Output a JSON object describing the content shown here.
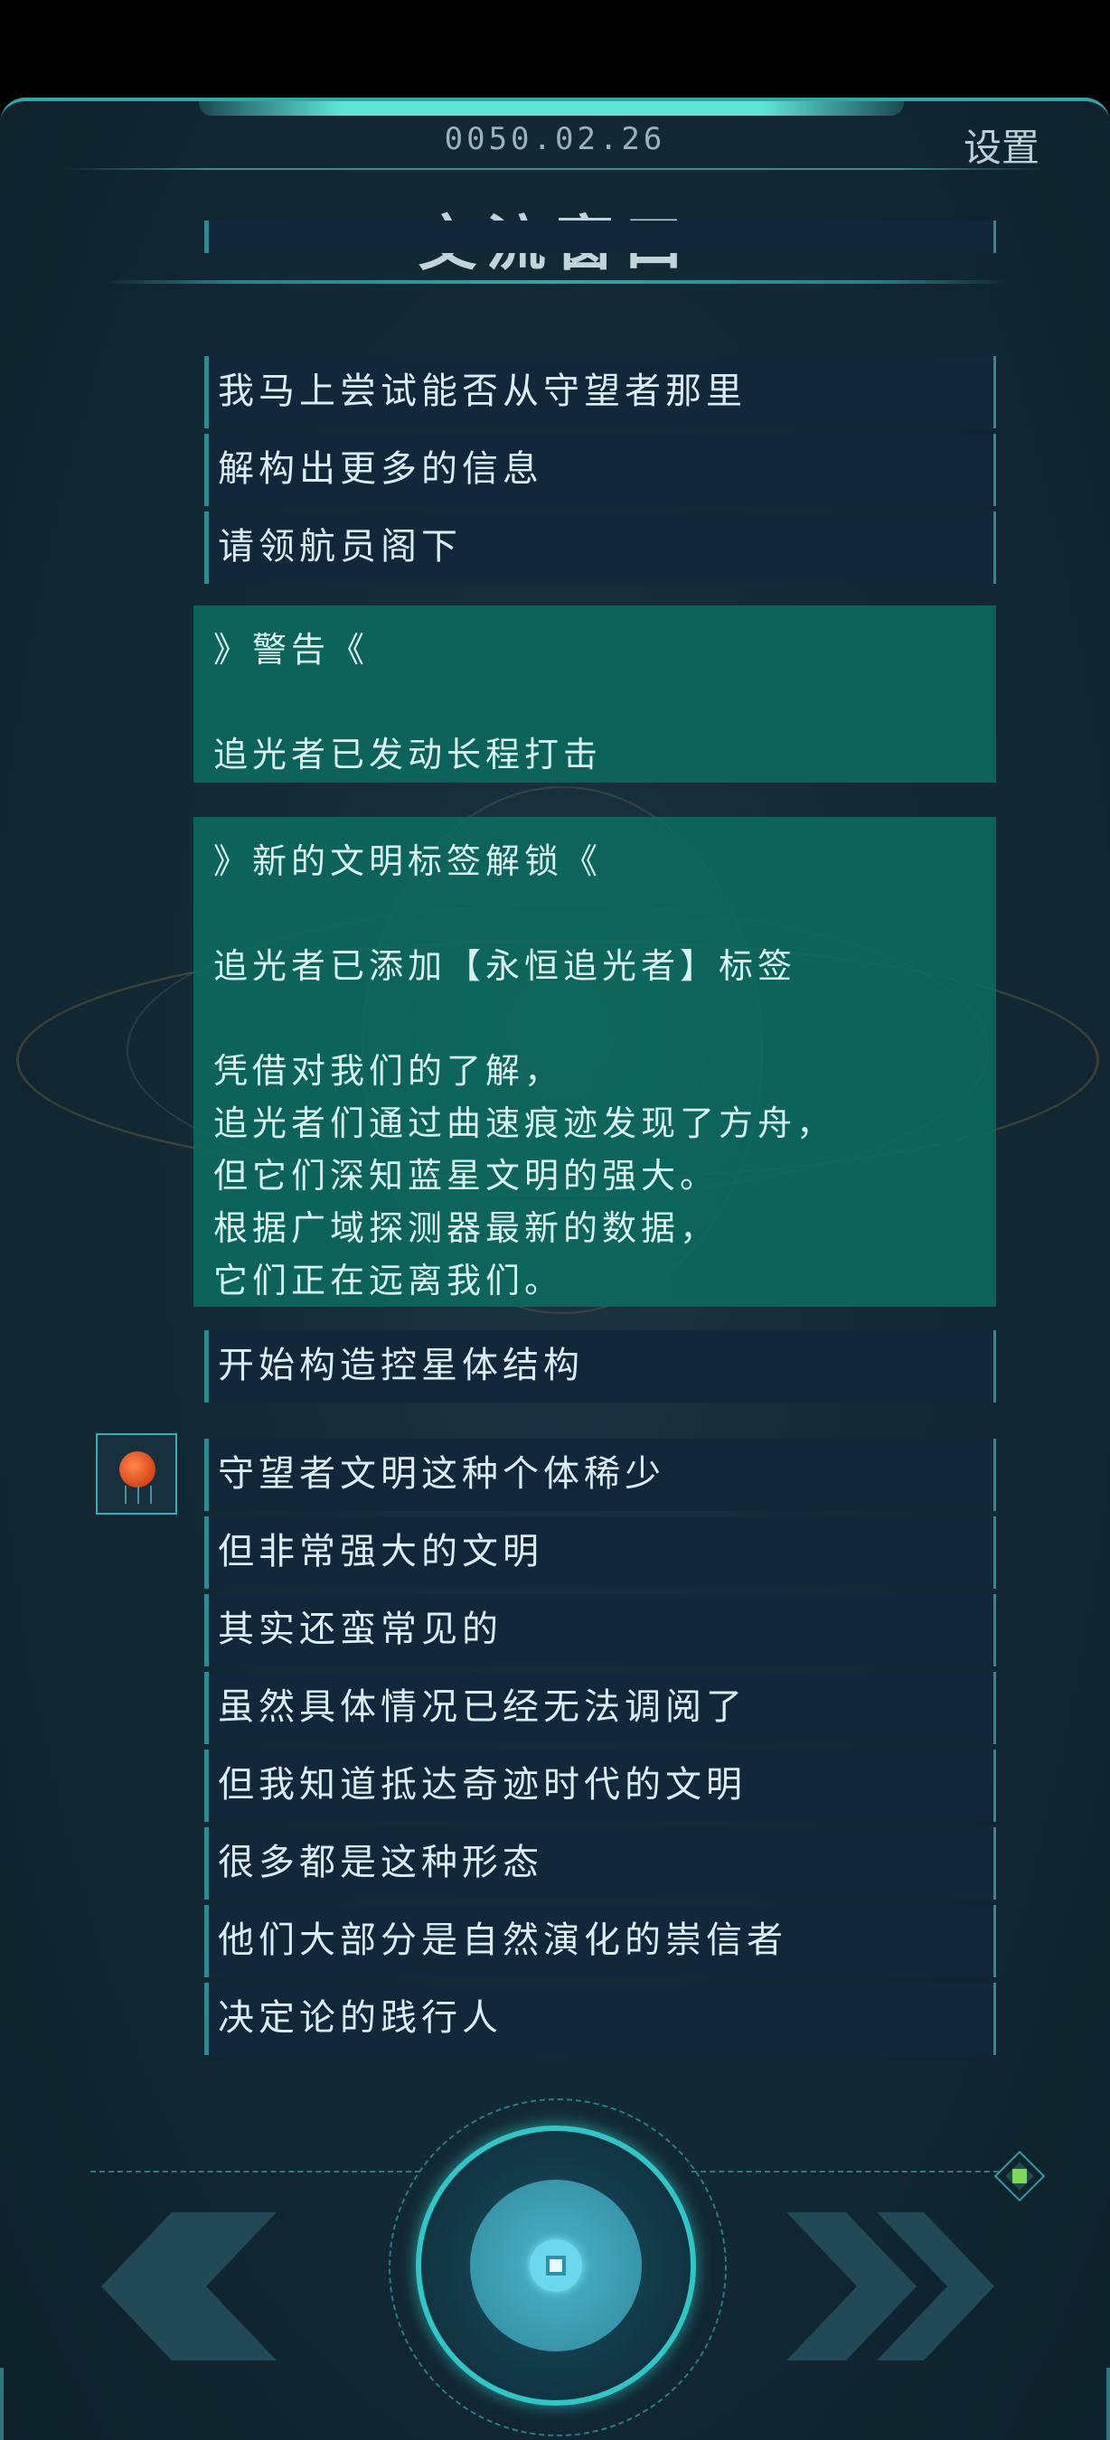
{
  "header": {
    "date": "0050.02.26",
    "settings_label": "设置",
    "title": "交流窗口"
  },
  "messages_top": [
    "我马上尝试能否从守望者那里",
    "解构出更多的信息",
    "请领航员阁下"
  ],
  "warning": {
    "heading": "》警告《",
    "body": "追光者已发动长程打击"
  },
  "unlock": {
    "heading": "》新的文明标签解锁《",
    "tag_line": "追光者已添加【永恒追光者】标签",
    "lines": [
      "凭借对我们的了解，",
      "追光者们通过曲速痕迹发现了方舟，",
      "但它们深知蓝星文明的强大。",
      "根据广域探测器最新的数据，",
      "它们正在远离我们。"
    ]
  },
  "message_mid": "开始构造控星体结构",
  "messages_bottom": [
    "守望者文明这种个体稀少",
    "但非常强大的文明",
    "其实还蛮常见的",
    "虽然具体情况已经无法调阅了",
    "但我知道抵达奇迹时代的文明",
    "很多都是这种形态",
    "他们大部分是自然演化的崇信者",
    "决定论的践行人"
  ],
  "colors": {
    "accent": "#2fc6c8",
    "bubble": "#12283a",
    "notice": "#0b6c60",
    "indicator": "#7ed957"
  },
  "icons": {
    "avatar": "watcher-avatar-icon",
    "prev": "double-chevron-left-icon",
    "next": "double-chevron-right-icon",
    "main": "main-action-icon",
    "status": "diamond-status-icon"
  }
}
